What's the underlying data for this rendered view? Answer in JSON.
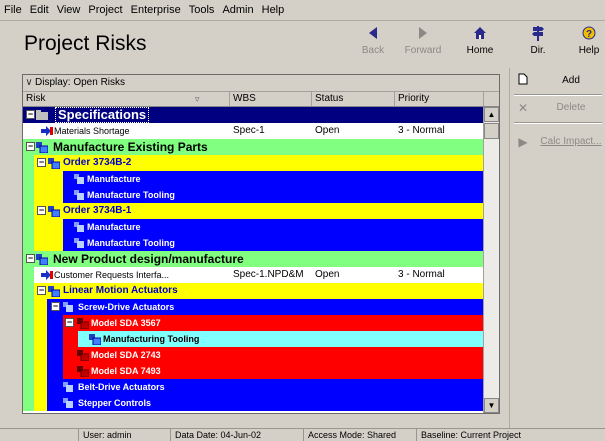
{
  "menu": [
    "File",
    "Edit",
    "View",
    "Project",
    "Enterprise",
    "Tools",
    "Admin",
    "Help"
  ],
  "header": {
    "title": "Project Risks"
  },
  "toolbar": [
    {
      "label": "Back",
      "icon": "back-arrow-icon"
    },
    {
      "label": "Forward",
      "icon": "forward-arrow-icon"
    },
    {
      "label": "Home",
      "icon": "home-icon"
    },
    {
      "label": "Dir.",
      "icon": "directory-signpost-icon"
    },
    {
      "label": "Help",
      "icon": "help-icon"
    }
  ],
  "grid": {
    "display_label": "Display: Open Risks",
    "columns": [
      "Risk",
      "WBS",
      "Status",
      "Priority"
    ],
    "rows": [
      {
        "label": "Specifications"
      },
      {
        "label": "Materials Shortage",
        "wbs": "Spec-1",
        "status": "Open",
        "priority": "3 - Normal"
      },
      {
        "label": "Manufacture Existing Parts"
      },
      {
        "label": "Order 3734B-2"
      },
      {
        "label": "Manufacture"
      },
      {
        "label": "Manufacture Tooling"
      },
      {
        "label": "Order 3734B-1"
      },
      {
        "label": "Manufacture"
      },
      {
        "label": "Manufacture Tooling"
      },
      {
        "label": "New Product design/manufacture"
      },
      {
        "label": "Customer Requests Interfa...",
        "wbs": "Spec-1.NPD&M",
        "status": "Open",
        "priority": "3 - Normal"
      },
      {
        "label": "Linear Motion Actuators"
      },
      {
        "label": "Screw-Drive Actuators"
      },
      {
        "label": "Model SDA 3567"
      },
      {
        "label": "Manufacturing Tooling"
      },
      {
        "label": "Model SDA 2743"
      },
      {
        "label": "Model SDA 7493"
      },
      {
        "label": "Belt-Drive Actuators"
      },
      {
        "label": "Stepper Controls"
      }
    ]
  },
  "colors": {
    "navy": "#0000ff",
    "green": "#80ff80",
    "yellow": "#ffff00",
    "red": "#ff0000",
    "cyan": "#80ffff",
    "specs_bg": "#000080"
  },
  "side": {
    "add": "Add",
    "delete": "Delete",
    "calc": "Calc Impact..."
  },
  "status": {
    "user": "User: admin",
    "data_date": "Data Date: 04-Jun-02",
    "access": "Access Mode: Shared",
    "baseline": "Baseline: Current Project"
  }
}
